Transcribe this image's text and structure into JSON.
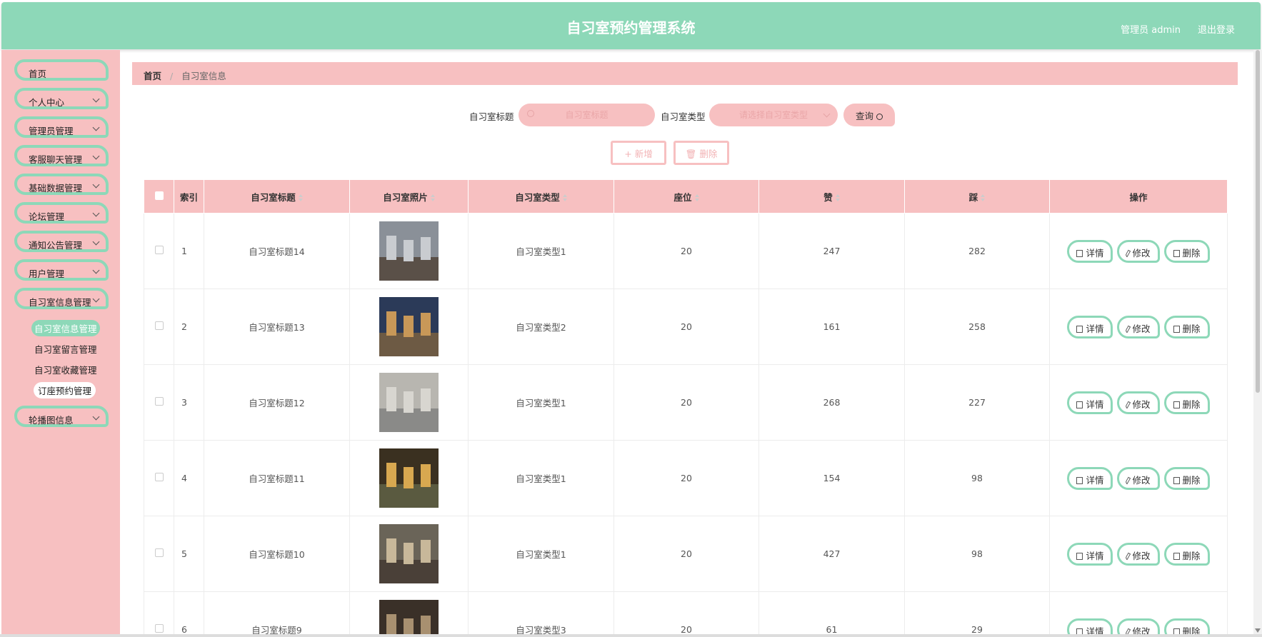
{
  "header": {
    "title": "自习室预约管理系统",
    "user": "管理员 admin",
    "logout": "退出登录"
  },
  "sidebar": {
    "items": [
      {
        "label": "首页"
      },
      {
        "label": "个人中心"
      },
      {
        "label": "管理员管理"
      },
      {
        "label": "客服聊天管理"
      },
      {
        "label": "基础数据管理"
      },
      {
        "label": "论坛管理"
      },
      {
        "label": "通知公告管理"
      },
      {
        "label": "用户管理"
      },
      {
        "label": "自习室信息管理"
      }
    ],
    "submenu": [
      {
        "label": "自习室信息管理"
      },
      {
        "label": "自习室留言管理"
      },
      {
        "label": "自习室收藏管理"
      },
      {
        "label": "订座预约管理"
      }
    ],
    "last_item": {
      "label": "轮播图信息"
    }
  },
  "breadcrumb": {
    "home": "首页",
    "separator": "/",
    "current": "自习室信息"
  },
  "search": {
    "title_label": "自习室标题",
    "title_placeholder": "自习室标题",
    "type_label": "自习室类型",
    "type_placeholder": "请选择自习室类型",
    "query_label": "查询"
  },
  "actions": {
    "add_label": "+ 新增",
    "delete_label": "删除"
  },
  "table": {
    "columns": [
      "索引",
      "自习室标题",
      "自习室照片",
      "自习室类型",
      "座位",
      "赞",
      "踩",
      "操作"
    ],
    "rows": [
      {
        "index": "1",
        "title": "自习室标题14",
        "type": "自习室类型1",
        "seats": "20",
        "likes": "247",
        "dislikes": "282"
      },
      {
        "index": "2",
        "title": "自习室标题13",
        "type": "自习室类型2",
        "seats": "20",
        "likes": "161",
        "dislikes": "258"
      },
      {
        "index": "3",
        "title": "自习室标题12",
        "type": "自习室类型1",
        "seats": "20",
        "likes": "268",
        "dislikes": "227"
      },
      {
        "index": "4",
        "title": "自习室标题11",
        "type": "自习室类型1",
        "seats": "20",
        "likes": "154",
        "dislikes": "98"
      },
      {
        "index": "5",
        "title": "自习室标题10",
        "type": "自习室类型1",
        "seats": "20",
        "likes": "427",
        "dislikes": "98"
      },
      {
        "index": "6",
        "title": "自习室标题9",
        "type": "自习室类型3",
        "seats": "20",
        "likes": "61",
        "dislikes": "29"
      }
    ],
    "op_labels": {
      "detail": "详情",
      "edit": "修改",
      "delete": "删除"
    }
  },
  "colors": {
    "accent_green": "#8dd8b8",
    "accent_pink": "#f7c0c1"
  }
}
